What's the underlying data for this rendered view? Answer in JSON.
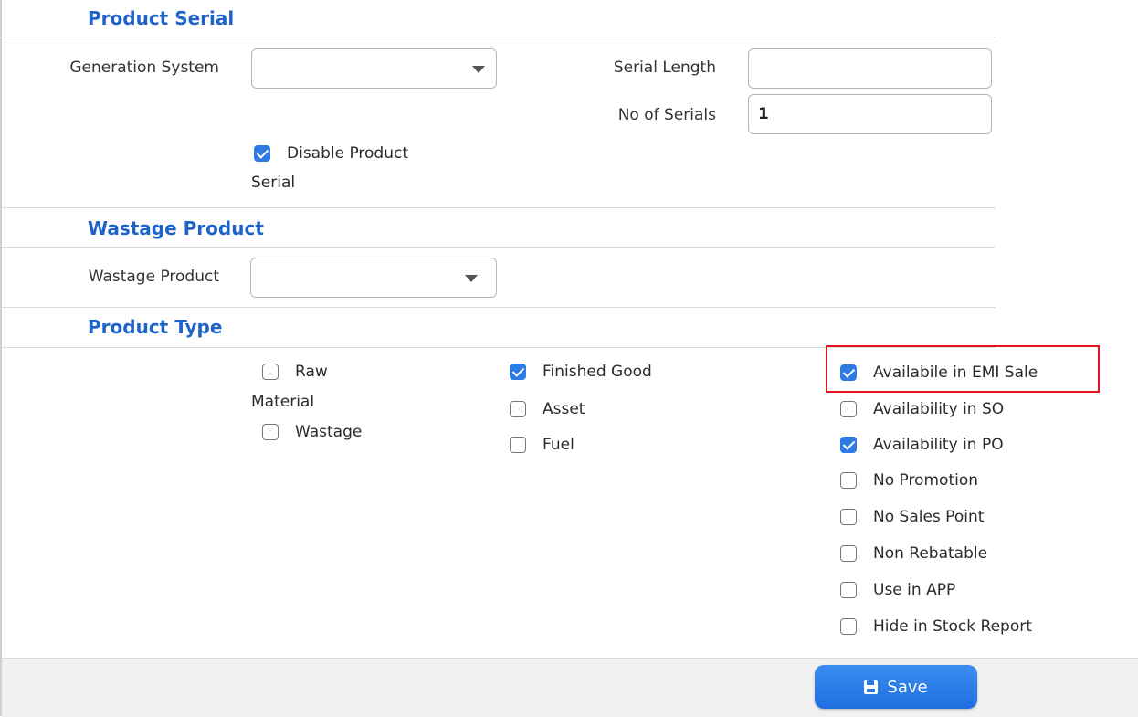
{
  "product_serial": {
    "title": "Product Serial",
    "generation_system_label": "Generation System",
    "generation_system_value": "",
    "serial_length_label": "Serial Length",
    "serial_length_value": "",
    "no_of_serials_label": "No of Serials",
    "no_of_serials_value": "1",
    "disable_product_serial": {
      "label_line1": "Disable Product",
      "label_line2": "Serial",
      "checked": true
    }
  },
  "wastage_product": {
    "title": "Wastage Product",
    "label": "Wastage Product",
    "value": ""
  },
  "product_type": {
    "title": "Product Type",
    "col1": [
      {
        "label_line1": "Raw",
        "label_line2": "Material",
        "checked": false
      },
      {
        "label": "Wastage",
        "checked": false
      }
    ],
    "col2": [
      {
        "label": "Finished Good",
        "checked": true
      },
      {
        "label": "Asset",
        "checked": false
      },
      {
        "label": "Fuel",
        "checked": false
      }
    ],
    "col3": [
      {
        "label": "Availabile in EMI Sale",
        "checked": true
      },
      {
        "label": "Availability in SO",
        "checked": false
      },
      {
        "label": "Availability in PO",
        "checked": true
      },
      {
        "label": "No Promotion",
        "checked": false
      },
      {
        "label": "No Sales Point",
        "checked": false
      },
      {
        "label": "Non Rebatable",
        "checked": false
      },
      {
        "label": "Use in APP",
        "checked": false
      },
      {
        "label": "Hide in Stock Report",
        "checked": false
      }
    ]
  },
  "footer": {
    "save_label": "Save"
  },
  "colors": {
    "accent": "#1e64c8",
    "checkbox": "#2f7be5",
    "highlight": "#e0141e"
  }
}
